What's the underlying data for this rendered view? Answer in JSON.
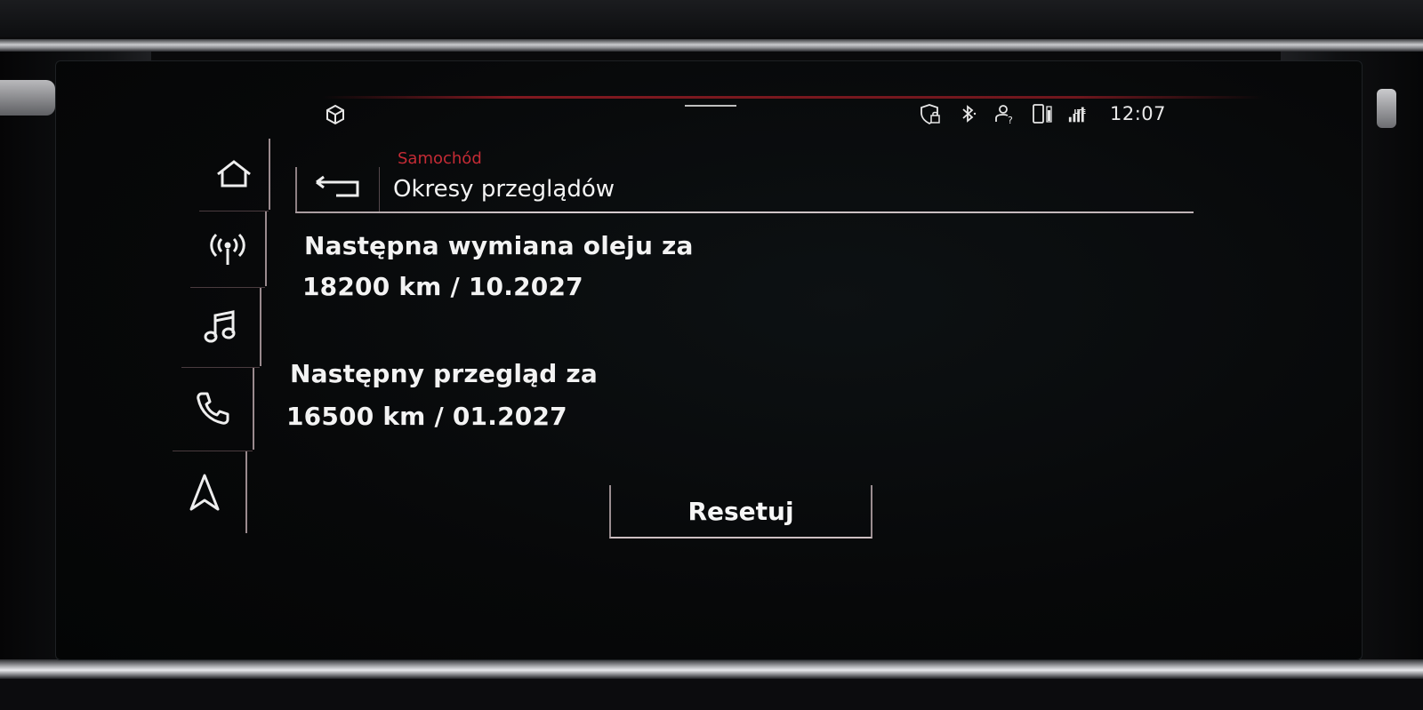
{
  "status_bar": {
    "left_icon": "car-settings-cube-icon",
    "icons": [
      "shield-lock-icon",
      "bluetooth-icon",
      "user-question-icon",
      "phone-battery-icon",
      "lte-signal-icon"
    ],
    "clock": "12:07"
  },
  "sidebar": {
    "items": [
      {
        "icon": "home-icon"
      },
      {
        "icon": "radio-antenna-icon"
      },
      {
        "icon": "music-note-icon"
      },
      {
        "icon": "phone-icon"
      },
      {
        "icon": "navigation-arrow-icon"
      }
    ]
  },
  "header": {
    "breadcrumb": "Samochód",
    "title": "Okresy przeglądów",
    "back_icon": "back-arrow-icon"
  },
  "service": {
    "oil_label": "Następna wymiana oleju za",
    "oil_value": "18200 km / 10.2027",
    "inspection_label": "Następny przegląd za",
    "inspection_value": "16500 km / 01.2027"
  },
  "actions": {
    "reset_label": "Resetuj"
  },
  "colors": {
    "accent": "#c42b35",
    "text": "#f3f3f3",
    "background": "#070809"
  }
}
